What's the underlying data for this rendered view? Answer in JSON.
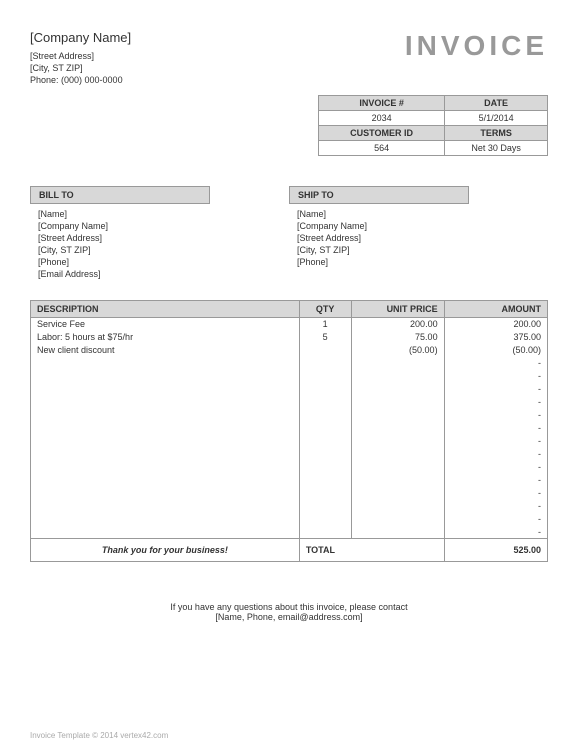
{
  "company": {
    "name": "[Company Name]",
    "street": "[Street Address]",
    "city_st_zip": "[City, ST  ZIP]",
    "phone": "Phone: (000) 000-0000"
  },
  "title": "INVOICE",
  "meta": {
    "invoice_num_label": "INVOICE #",
    "date_label": "DATE",
    "invoice_num": "2034",
    "date": "5/1/2014",
    "customer_id_label": "CUSTOMER ID",
    "terms_label": "TERMS",
    "customer_id": "564",
    "terms": "Net 30 Days"
  },
  "bill_to": {
    "header": "BILL TO",
    "lines": [
      "[Name]",
      "[Company Name]",
      "[Street Address]",
      "[City, ST  ZIP]",
      "[Phone]",
      "[Email Address]"
    ]
  },
  "ship_to": {
    "header": "SHIP TO",
    "lines": [
      "[Name]",
      "[Company Name]",
      "[Street Address]",
      "[City, ST  ZIP]",
      "[Phone]"
    ]
  },
  "columns": {
    "desc": "DESCRIPTION",
    "qty": "QTY",
    "price": "UNIT PRICE",
    "amount": "AMOUNT"
  },
  "items": [
    {
      "desc": "Service Fee",
      "qty": "1",
      "price": "200.00",
      "amount": "200.00"
    },
    {
      "desc": "Labor: 5 hours at $75/hr",
      "qty": "5",
      "price": "75.00",
      "amount": "375.00"
    },
    {
      "desc": "New client discount",
      "qty": "",
      "price": "(50.00)",
      "amount": "(50.00)"
    },
    {
      "desc": "",
      "qty": "",
      "price": "",
      "amount": "-"
    },
    {
      "desc": "",
      "qty": "",
      "price": "",
      "amount": "-"
    },
    {
      "desc": "",
      "qty": "",
      "price": "",
      "amount": "-"
    },
    {
      "desc": "",
      "qty": "",
      "price": "",
      "amount": "-"
    },
    {
      "desc": "",
      "qty": "",
      "price": "",
      "amount": "-"
    },
    {
      "desc": "",
      "qty": "",
      "price": "",
      "amount": "-"
    },
    {
      "desc": "",
      "qty": "",
      "price": "",
      "amount": "-"
    },
    {
      "desc": "",
      "qty": "",
      "price": "",
      "amount": "-"
    },
    {
      "desc": "",
      "qty": "",
      "price": "",
      "amount": "-"
    },
    {
      "desc": "",
      "qty": "",
      "price": "",
      "amount": "-"
    },
    {
      "desc": "",
      "qty": "",
      "price": "",
      "amount": "-"
    },
    {
      "desc": "",
      "qty": "",
      "price": "",
      "amount": "-"
    },
    {
      "desc": "",
      "qty": "",
      "price": "",
      "amount": "-"
    },
    {
      "desc": "",
      "qty": "",
      "price": "",
      "amount": "-"
    }
  ],
  "thankyou": "Thank you for your business!",
  "total_label": "TOTAL",
  "total": "525.00",
  "contact_line1": "If you have any questions about this invoice, please contact",
  "contact_line2": "[Name, Phone, email@address.com]",
  "copyright": "Invoice Template © 2014 vertex42.com"
}
